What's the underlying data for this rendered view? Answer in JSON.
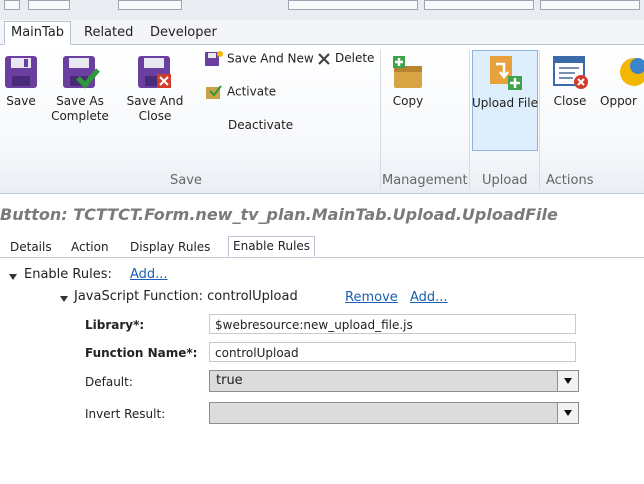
{
  "ribbon": {
    "tabs": [
      "MainTab",
      "Related",
      "Developer"
    ],
    "active_tab": "MainTab",
    "groups": {
      "save": {
        "label": "Save",
        "save": "Save",
        "save_as_complete_1": "Save As",
        "save_as_complete_2": "Complete",
        "save_and_close": "Save And Close",
        "save_and_new": "Save And New",
        "delete": "Delete",
        "activate": "Activate",
        "deactivate": "Deactivate"
      },
      "management": {
        "label": "Management",
        "copy": "Copy"
      },
      "upload": {
        "label": "Upload",
        "upload_file": "Upload File"
      },
      "actions": {
        "label": "Actions",
        "close": "Close",
        "opportunity": "Oppor"
      }
    }
  },
  "page_title": "Button: TCTTCT.Form.new_tv_plan.MainTab.Upload.UploadFile",
  "subtabs": [
    "Details",
    "Action",
    "Display Rules",
    "Enable Rules"
  ],
  "active_subtab": "Enable Rules",
  "tree": {
    "enable_rules_label": "Enable Rules:",
    "add_link": "Add...",
    "function_label": "JavaScript Function: controlUpload",
    "remove_link": "Remove",
    "add_link_2": "Add..."
  },
  "props": {
    "library_label": "Library*:",
    "library_value": "$webresource:new_upload_file.js",
    "function_name_label": "Function Name*:",
    "function_name_value": "controlUpload",
    "default_label": "Default:",
    "default_value": "true",
    "invert_result_label": "Invert Result:",
    "invert_result_value": ""
  },
  "colors": {
    "link": "#1a5fb4",
    "title": "#7a7a7a",
    "highlight": "#dfeefc"
  }
}
